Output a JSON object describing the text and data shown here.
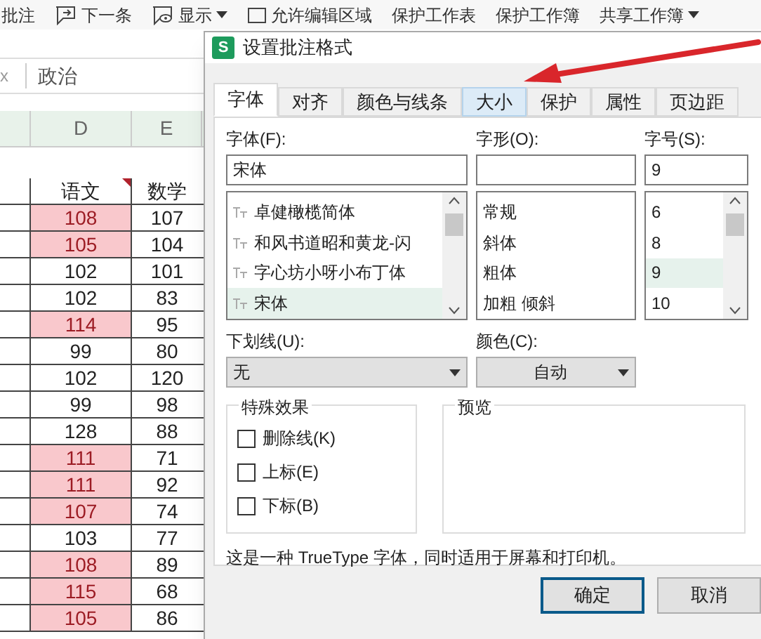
{
  "toolbar": {
    "items": [
      {
        "label": "批注",
        "dropdown": false
      },
      {
        "label": "下一条",
        "dropdown": false
      },
      {
        "label": "显示",
        "dropdown": true
      },
      {
        "label": "允许编辑区域",
        "dropdown": false
      },
      {
        "label": "保护工作表",
        "dropdown": false
      },
      {
        "label": "保护工作簿",
        "dropdown": false
      },
      {
        "label": "共享工作簿",
        "dropdown": true
      }
    ]
  },
  "formula_bar": {
    "fx": "x",
    "value": "政治"
  },
  "sheet": {
    "columns": [
      "D",
      "E"
    ],
    "header": [
      "语文",
      "数学"
    ],
    "rows": [
      {
        "d": "108",
        "e": "107",
        "highlight": true
      },
      {
        "d": "105",
        "e": "104",
        "highlight": true
      },
      {
        "d": "102",
        "e": "101",
        "highlight": false
      },
      {
        "d": "102",
        "e": "83",
        "highlight": false
      },
      {
        "d": "114",
        "e": "95",
        "highlight": true
      },
      {
        "d": "99",
        "e": "80",
        "highlight": false
      },
      {
        "d": "102",
        "e": "120",
        "highlight": false
      },
      {
        "d": "99",
        "e": "98",
        "highlight": false
      },
      {
        "d": "128",
        "e": "88",
        "highlight": false
      },
      {
        "d": "111",
        "e": "71",
        "highlight": true
      },
      {
        "d": "111",
        "e": "92",
        "highlight": true
      },
      {
        "d": "107",
        "e": "74",
        "highlight": true
      },
      {
        "d": "103",
        "e": "77",
        "highlight": false
      },
      {
        "d": "108",
        "e": "89",
        "highlight": true
      },
      {
        "d": "115",
        "e": "68",
        "highlight": true
      },
      {
        "d": "105",
        "e": "86",
        "highlight": true
      }
    ]
  },
  "dialog": {
    "title": "设置批注格式",
    "app_icon": "S",
    "tabs": [
      {
        "label": "字体",
        "selected": true,
        "hover": false
      },
      {
        "label": "对齐",
        "selected": false,
        "hover": false
      },
      {
        "label": "颜色与线条",
        "selected": false,
        "hover": false
      },
      {
        "label": "大小",
        "selected": false,
        "hover": true
      },
      {
        "label": "保护",
        "selected": false,
        "hover": false
      },
      {
        "label": "属性",
        "selected": false,
        "hover": false
      },
      {
        "label": "页边距",
        "selected": false,
        "hover": false
      }
    ],
    "font": {
      "label": "字体(F):",
      "value": "宋体",
      "items": [
        {
          "label": "卓健橄榄简体",
          "selected": false
        },
        {
          "label": "和风书道昭和黄龙-闪",
          "selected": false
        },
        {
          "label": "字心坊小呀小布丁体",
          "selected": false
        },
        {
          "label": "宋体",
          "selected": true
        }
      ]
    },
    "style": {
      "label": "字形(O):",
      "items": [
        {
          "label": "常规",
          "selected": false
        },
        {
          "label": "斜体",
          "selected": false
        },
        {
          "label": "粗体",
          "selected": false
        },
        {
          "label": "加粗 倾斜",
          "selected": false
        }
      ]
    },
    "size": {
      "label": "字号(S):",
      "value": "9",
      "items": [
        {
          "label": "6",
          "selected": false
        },
        {
          "label": "8",
          "selected": false
        },
        {
          "label": "9",
          "selected": true
        },
        {
          "label": "10",
          "selected": false
        }
      ]
    },
    "underline": {
      "label": "下划线(U):",
      "value": "无"
    },
    "color": {
      "label": "颜色(C):",
      "value": "自动"
    },
    "effects": {
      "title": "特殊效果",
      "options": [
        {
          "label": "删除线(K)",
          "checked": false
        },
        {
          "label": "上标(E)",
          "checked": false
        },
        {
          "label": "下标(B)",
          "checked": false
        }
      ]
    },
    "preview": {
      "title": "预览"
    },
    "note": "这是一种 TrueType 字体，同时适用于屏幕和打印机。",
    "buttons": [
      {
        "label": "确定",
        "default": true
      },
      {
        "label": "取消",
        "default": false
      }
    ]
  }
}
